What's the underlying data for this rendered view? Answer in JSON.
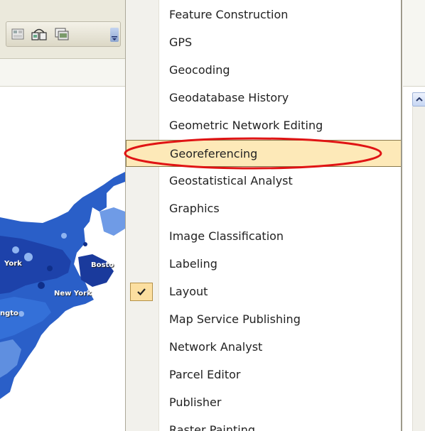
{
  "menu": {
    "items": [
      {
        "label": "Feature Construction",
        "checked": false,
        "highlighted": false
      },
      {
        "label": "GPS",
        "checked": false,
        "highlighted": false
      },
      {
        "label": "Geocoding",
        "checked": false,
        "highlighted": false
      },
      {
        "label": "Geodatabase History",
        "checked": false,
        "highlighted": false
      },
      {
        "label": "Geometric Network Editing",
        "checked": false,
        "highlighted": false
      },
      {
        "label": "Georeferencing",
        "checked": false,
        "highlighted": true
      },
      {
        "label": "Geostatistical Analyst",
        "checked": false,
        "highlighted": false
      },
      {
        "label": "Graphics",
        "checked": false,
        "highlighted": false
      },
      {
        "label": "Image Classification",
        "checked": false,
        "highlighted": false
      },
      {
        "label": "Labeling",
        "checked": false,
        "highlighted": false
      },
      {
        "label": "Layout",
        "checked": true,
        "highlighted": false
      },
      {
        "label": "Map Service Publishing",
        "checked": false,
        "highlighted": false
      },
      {
        "label": "Network Analyst",
        "checked": false,
        "highlighted": false
      },
      {
        "label": "Parcel Editor",
        "checked": false,
        "highlighted": false
      },
      {
        "label": "Publisher",
        "checked": false,
        "highlighted": false
      },
      {
        "label": "Raster Painting",
        "checked": false,
        "highlighted": false
      }
    ]
  },
  "map": {
    "labels": [
      "York",
      "Bosto",
      "New York",
      "ngto"
    ]
  },
  "colors": {
    "highlight": "#fde9b8",
    "annotation": "#e01414",
    "check_bg": "#fcdfa0",
    "map_land": "#2a5fc8"
  },
  "icons": [
    "catalog-icon",
    "toolbar-tool-icon",
    "toolbar-window-icon",
    "toolbar-overflow-icon",
    "check-icon",
    "scroll-up-arrow-icon"
  ]
}
